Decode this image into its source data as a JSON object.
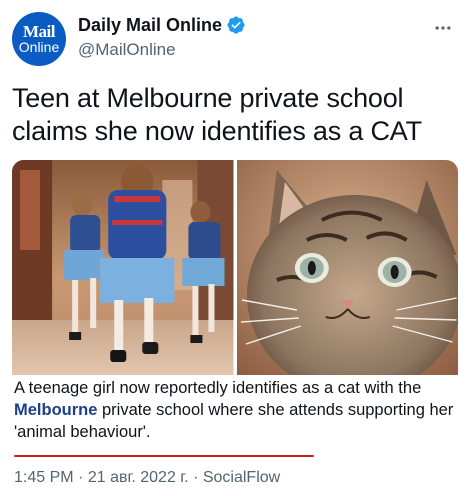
{
  "account": {
    "avatar_line1": "Mail",
    "avatar_line2": "Online",
    "display_name": "Daily Mail Online",
    "handle": "@MailOnline",
    "verified": true
  },
  "tweet": {
    "headline_line1": "Teen at Melbourne private school",
    "headline_line2": "claims she now identifies as a CAT",
    "caption_part1": "A teenage girl now reportedly identifies as a cat with the ",
    "caption_bold": "Melbourne",
    "caption_part2": " private school where she attends supporting her 'animal behaviour'.",
    "time": "1:45 PM",
    "separator": "·",
    "date": "21 авг. 2022 г.",
    "source": "SocialFlow"
  },
  "media": [
    {
      "icon": "schoolgirls-running-photo"
    },
    {
      "icon": "tabby-cat-photo"
    }
  ],
  "colors": {
    "avatar_bg": "#0a5cc2",
    "verified": "#1d9bf0",
    "highlight_underline": "#d01c1c",
    "secondary_text": "#536471"
  }
}
